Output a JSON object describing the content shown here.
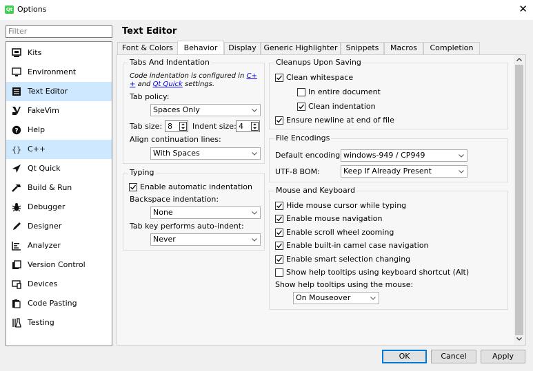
{
  "window": {
    "title": "Options",
    "logo_text": "Qt"
  },
  "filter": {
    "placeholder": "Filter"
  },
  "sidebar": {
    "items": [
      {
        "label": "Kits",
        "icon": "monitor-chip-icon"
      },
      {
        "label": "Environment",
        "icon": "monitor-icon"
      },
      {
        "label": "Text Editor",
        "icon": "text-editor-icon",
        "selected": true
      },
      {
        "label": "FakeVim",
        "icon": "fakevim-icon"
      },
      {
        "label": "Help",
        "icon": "help-icon"
      },
      {
        "label": "C++",
        "icon": "braces-icon",
        "glyph": "{}",
        "hovered": true
      },
      {
        "label": "Qt Quick",
        "icon": "qt-quick-icon"
      },
      {
        "label": "Build & Run",
        "icon": "hammer-icon"
      },
      {
        "label": "Debugger",
        "icon": "bug-icon"
      },
      {
        "label": "Designer",
        "icon": "pencil-icon"
      },
      {
        "label": "Analyzer",
        "icon": "analyzer-icon"
      },
      {
        "label": "Version Control",
        "icon": "version-control-icon"
      },
      {
        "label": "Devices",
        "icon": "devices-icon"
      },
      {
        "label": "Code Pasting",
        "icon": "clipboard-icon"
      },
      {
        "label": "Testing",
        "icon": "flask-icon"
      }
    ]
  },
  "page_title": "Text Editor",
  "tabs": [
    {
      "label": "Font & Colors"
    },
    {
      "label": "Behavior",
      "active": true
    },
    {
      "label": "Display"
    },
    {
      "label": "Generic Highlighter"
    },
    {
      "label": "Snippets"
    },
    {
      "label": "Macros"
    },
    {
      "label": "Completion"
    }
  ],
  "tabs_and_indentation": {
    "title": "Tabs And Indentation",
    "note_prefix": "Code indentation is configured in ",
    "note_link1_a": "C+",
    "note_link1_b": "+",
    "note_mid": " and ",
    "note_link2": "Qt Quick",
    "note_suffix": " settings.",
    "tab_policy_label": "Tab policy:",
    "tab_policy_value": "Spaces Only",
    "tab_size_label": "Tab size:",
    "tab_size_value": "8",
    "indent_size_label": "Indent size:",
    "indent_size_value": "4",
    "align_label": "Align continuation lines:",
    "align_value": "With Spaces"
  },
  "typing": {
    "title": "Typing",
    "auto_indent_label": "Enable automatic indentation",
    "auto_indent_checked": true,
    "backspace_label": "Backspace indentation:",
    "backspace_value": "None",
    "tab_key_label": "Tab key performs auto-indent:",
    "tab_key_value": "Never"
  },
  "cleanups": {
    "title": "Cleanups Upon Saving",
    "clean_whitespace_label": "Clean whitespace",
    "clean_whitespace_checked": true,
    "entire_document_label": "In entire document",
    "entire_document_checked": false,
    "clean_indentation_label": "Clean indentation",
    "clean_indentation_checked": true,
    "ensure_newline_label": "Ensure newline at end of file",
    "ensure_newline_checked": true
  },
  "file_encodings": {
    "title": "File Encodings",
    "default_encoding_label": "Default encoding:",
    "default_encoding_value": "windows-949 / CP949",
    "utf8_bom_label": "UTF-8 BOM:",
    "utf8_bom_value": "Keep If Already Present"
  },
  "mouse_keyboard": {
    "title": "Mouse and Keyboard",
    "options": [
      {
        "label": "Hide mouse cursor while typing",
        "checked": true
      },
      {
        "label": "Enable mouse navigation",
        "checked": true
      },
      {
        "label": "Enable scroll wheel zooming",
        "checked": true
      },
      {
        "label": "Enable built-in camel case navigation",
        "checked": true
      },
      {
        "label": "Enable smart selection changing",
        "checked": true
      },
      {
        "label": "Show help tooltips using keyboard shortcut (Alt)",
        "checked": false
      }
    ],
    "tooltips_mouse_label": "Show help tooltips using the mouse:",
    "tooltips_mouse_value": "On Mouseover"
  },
  "buttons": {
    "ok": "OK",
    "cancel": "Cancel",
    "apply": "Apply"
  },
  "colors": {
    "selected_bg": "#cde8ff",
    "link": "#0000ee",
    "default_button_border": "#0078d7",
    "qt_logo": "#41cd52"
  }
}
